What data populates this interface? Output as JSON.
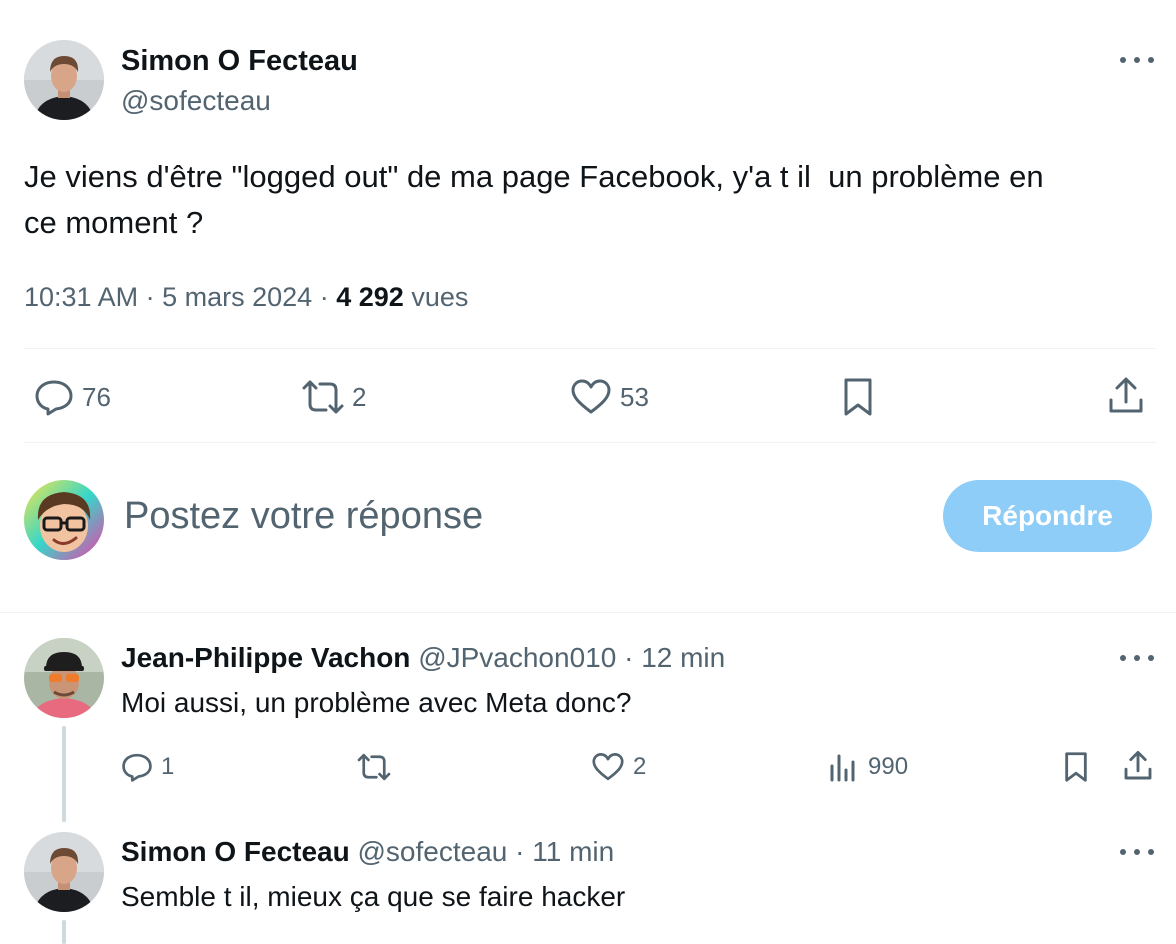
{
  "main_tweet": {
    "author_name": "Simon O Fecteau",
    "author_handle": "@sofecteau",
    "text_line1": "Je viens d'être \"logged out\" de ma page Facebook, y'a t il  un problème en",
    "text_line2": "ce moment ?",
    "time": "10:31 AM",
    "date": "5 mars 2024",
    "views_count": "4 292",
    "views_label": "vues",
    "separator": "·",
    "stats": {
      "replies": "76",
      "retweets": "2",
      "likes": "53"
    }
  },
  "composer": {
    "placeholder": "Postez votre réponse",
    "reply_button": "Répondre",
    "accent_color": "#8ecdf7"
  },
  "replies": [
    {
      "author_name": "Jean-Philippe Vachon",
      "author_handle": "@JPvachon010",
      "time": "12 min",
      "text": "Moi aussi, un problème avec Meta donc?",
      "stats": {
        "replies": "1",
        "retweets": "",
        "likes": "2",
        "views": "990"
      }
    },
    {
      "author_name": "Simon O Fecteau",
      "author_handle": "@sofecteau",
      "time": "11 min",
      "text": "Semble t il, mieux ça que se faire hacker"
    }
  ],
  "icons": [
    "more-icon",
    "reply-icon",
    "retweet-icon",
    "like-icon",
    "bookmark-icon",
    "share-icon",
    "views-icon"
  ]
}
